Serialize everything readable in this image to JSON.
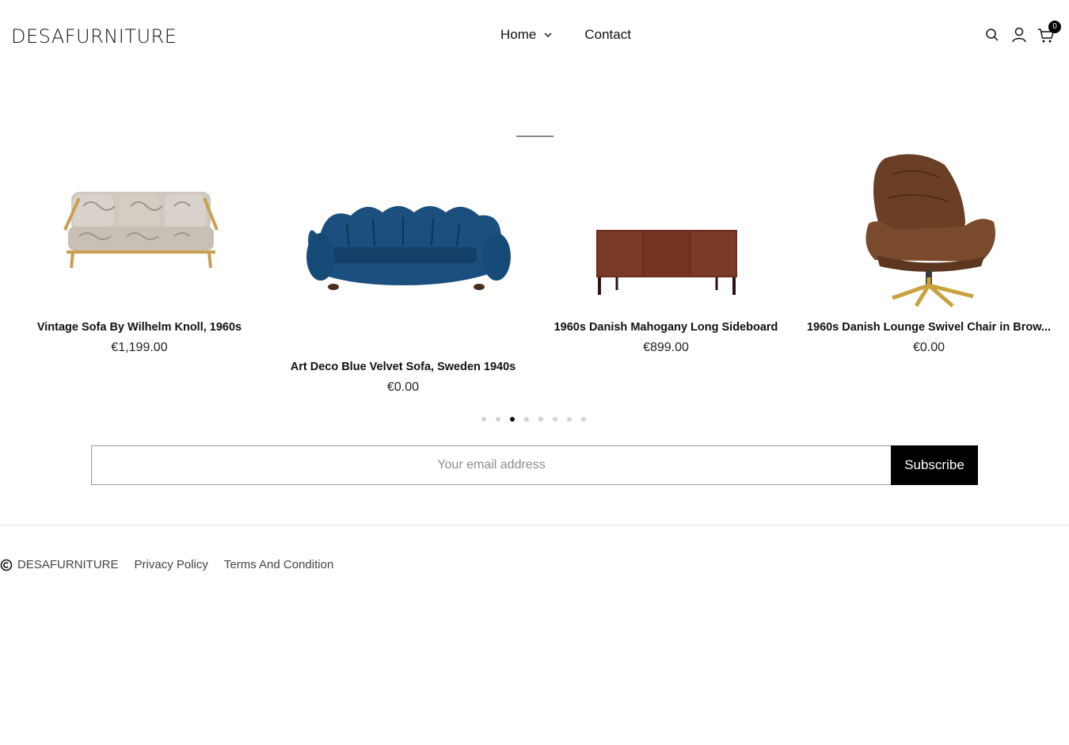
{
  "header": {
    "logo_text": "DESAFURNITURE",
    "nav": [
      {
        "label": "Home",
        "has_dropdown": true
      },
      {
        "label": "Contact",
        "has_dropdown": false
      }
    ],
    "icons": [
      "search-icon",
      "account-icon",
      "cart-icon"
    ],
    "cart_count": "0"
  },
  "carousel": {
    "products": [
      {
        "name": "Vintage Sofa By Wilhelm Knoll, 1960s",
        "price": "€1,199.00",
        "image": "beige-patterned-sofa"
      },
      {
        "name": "Art Deco Blue Velvet Sofa, Sweden 1940s",
        "price": "€0.00",
        "image": "blue-velvet-sofa"
      },
      {
        "name": "1960s Danish Mahogany Long Sideboard",
        "price": "€899.00",
        "image": "mahogany-sideboard"
      },
      {
        "name": "1960s Danish Lounge Swivel Chair in Brow...",
        "price": "€0.00",
        "image": "brown-leather-swivel-chair"
      }
    ],
    "dot_count": 8,
    "active_dot": 2
  },
  "newsletter": {
    "placeholder": "Your email address",
    "button_label": "Subscribe"
  },
  "footer": {
    "brand": "DESAFURNITURE",
    "links": [
      "Privacy Policy",
      "Terms And Condition"
    ]
  },
  "colors": {
    "accent": "#000000",
    "text": "#111111",
    "muted": "#8c8c8c"
  }
}
